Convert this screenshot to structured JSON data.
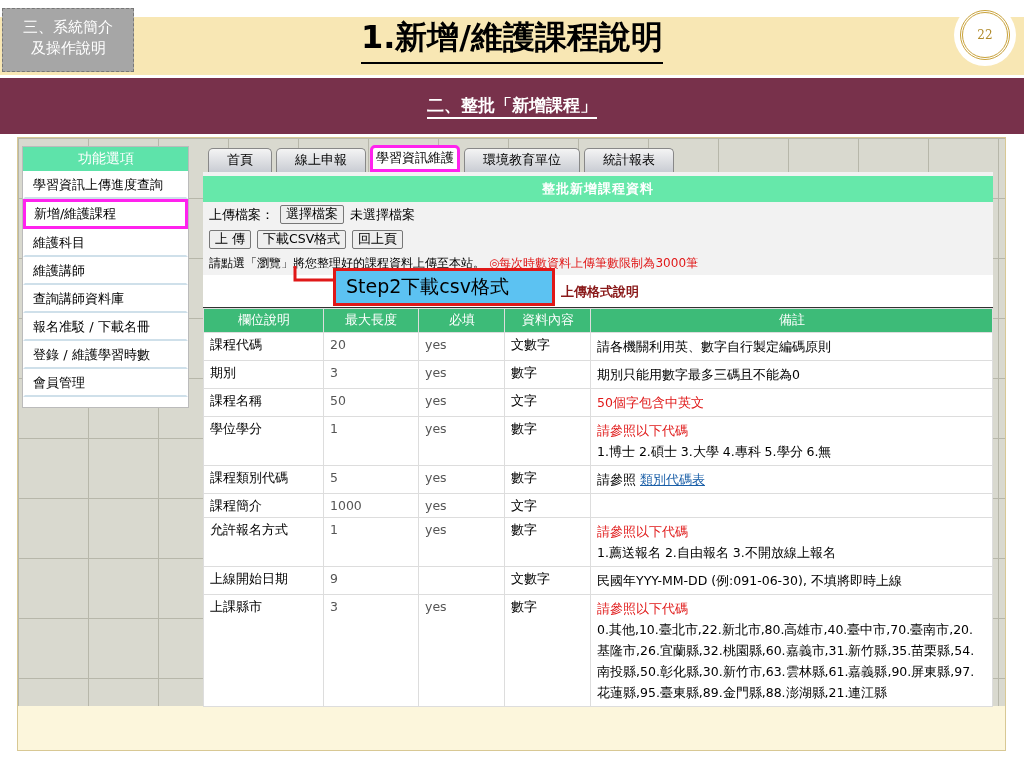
{
  "slide": {
    "section": [
      "三、系統簡介",
      "及操作說明"
    ],
    "title": "1.新增/維護課程說明",
    "page_number": "22",
    "banner": "二、整批「新增課程」"
  },
  "sidebar": {
    "title": "功能選項",
    "items": [
      {
        "label": "學習資訊上傳進度查詢",
        "highlighted": false
      },
      {
        "label": "新增/維護課程",
        "highlighted": true
      },
      {
        "label": "維護科目",
        "highlighted": false
      },
      {
        "label": "維護講師",
        "highlighted": false
      },
      {
        "label": "查詢講師資料庫",
        "highlighted": false
      },
      {
        "label": "報名准駁 / 下載名冊",
        "highlighted": false
      },
      {
        "label": "登錄 / 維護學習時數",
        "highlighted": false
      },
      {
        "label": "會員管理",
        "highlighted": false
      }
    ]
  },
  "tabs": [
    {
      "label": "首頁",
      "selected": false
    },
    {
      "label": "線上申報",
      "selected": false
    },
    {
      "label": "學習資訊維護",
      "selected": true
    },
    {
      "label": "環境教育單位",
      "selected": false
    },
    {
      "label": "統計報表",
      "selected": false
    }
  ],
  "panel": {
    "title": "整批新增課程資料",
    "upload_label": "上傳檔案：",
    "file_button": "選擇檔案",
    "file_status": "未選擇檔案",
    "buttons": [
      "上 傳",
      "下載CSV格式",
      "回上頁"
    ],
    "instruction": "請點選「瀏覽」將您整理好的課程資料上傳至本站。",
    "limit_note": "◎每次時數資料上傳筆數限制為3000筆",
    "format_title": "上傳格式說明"
  },
  "callout": {
    "text": "Step2下載csv格式"
  },
  "table": {
    "columns": [
      "欄位說明",
      "最大長度",
      "必填",
      "資料內容",
      "備註"
    ],
    "rows": [
      {
        "cells": [
          "課程代碼",
          "20",
          "yes",
          "文數字"
        ],
        "remarks": [
          [
            {
              "kind": "plain",
              "text": "請各機關利用英、數字自行製定編碼原則"
            }
          ]
        ]
      },
      {
        "cells": [
          "期別",
          "3",
          "yes",
          "數字"
        ],
        "remarks": [
          [
            {
              "kind": "plain",
              "text": "期別只能用數字最多三碼且不能為0"
            }
          ]
        ]
      },
      {
        "cells": [
          "課程名稱",
          "50",
          "yes",
          "文字"
        ],
        "remarks": [
          [
            {
              "kind": "warn",
              "text": "50個字包含中英文"
            }
          ]
        ]
      },
      {
        "cells": [
          "學位學分",
          "1",
          "yes",
          "數字"
        ],
        "remarks": [
          [
            {
              "kind": "warn",
              "text": "請參照以下代碼"
            }
          ],
          [
            {
              "kind": "plain",
              "text": "1.博士 2.碩士 3.大學 4.專科 5.學分 6.無"
            }
          ]
        ]
      },
      {
        "cells": [
          "課程類別代碼",
          "5",
          "yes",
          "數字"
        ],
        "remarks": [
          [
            {
              "kind": "plain",
              "text": "請參照 "
            },
            {
              "kind": "link",
              "text": "類別代碼表"
            }
          ]
        ]
      },
      {
        "cells": [
          "課程簡介",
          "1000",
          "yes",
          "文字"
        ],
        "remarks": []
      },
      {
        "cells": [
          "允許報名方式",
          "1",
          "yes",
          "數字"
        ],
        "remarks": [
          [
            {
              "kind": "warn",
              "text": "請參照以下代碼"
            }
          ],
          [
            {
              "kind": "plain",
              "text": "1.薦送報名 2.自由報名 3.不開放線上報名"
            }
          ]
        ]
      },
      {
        "cells": [
          "上線開始日期",
          "9",
          "",
          "文數字"
        ],
        "remarks": [
          [
            {
              "kind": "plain",
              "text": "民國年YYY-MM-DD (例:091-06-30), 不填將即時上線"
            }
          ]
        ]
      },
      {
        "cells": [
          "上課縣市",
          "3",
          "yes",
          "數字"
        ],
        "remarks": [
          [
            {
              "kind": "warn",
              "text": "請參照以下代碼"
            }
          ],
          [
            {
              "kind": "plain",
              "text": "0.其他,10.臺北市,22.新北市,80.高雄市,40.臺中市,70.臺南市,20.基隆市,26.宜蘭縣,32.桃園縣,60.嘉義市,31.新竹縣,35.苗栗縣,54.南投縣,50.彰化縣,30.新竹市,63.雲林縣,61.嘉義縣,90.屏東縣,97.花蓮縣,95.臺東縣,89.金門縣,88.澎湖縣,21.連江縣"
            }
          ]
        ]
      }
    ]
  }
}
